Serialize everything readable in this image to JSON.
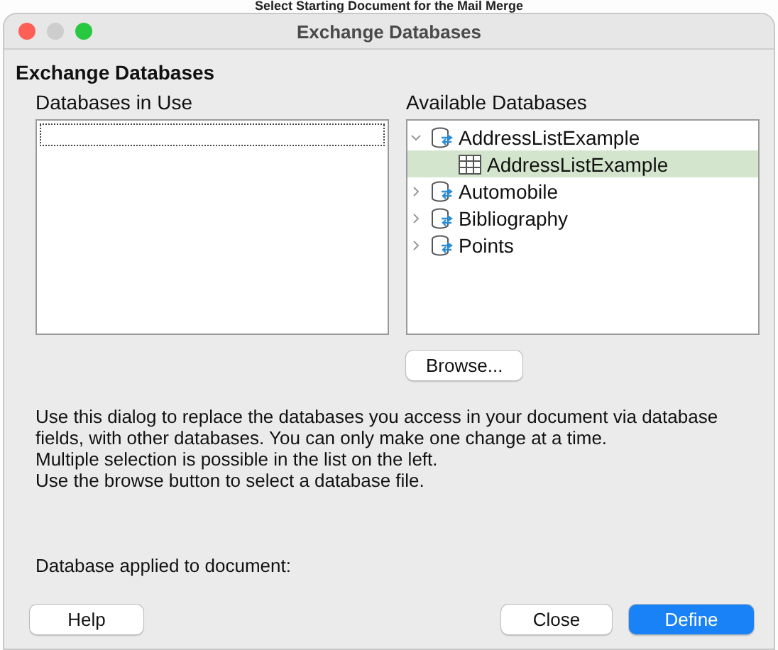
{
  "background_window": {
    "title": "Select Starting Document for the Mail Merge"
  },
  "window": {
    "title": "Exchange Databases"
  },
  "heading": "Exchange Databases",
  "databases_in_use": {
    "label": "Databases in Use"
  },
  "available_databases": {
    "label": "Available Databases",
    "items": [
      {
        "label": "AddressListExample",
        "kind": "database",
        "expanded": true,
        "selected": false,
        "children": [
          {
            "label": "AddressListExample",
            "kind": "table",
            "selected": true
          }
        ]
      },
      {
        "label": "Automobile",
        "kind": "database",
        "expanded": false,
        "selected": false
      },
      {
        "label": "Bibliography",
        "kind": "database",
        "expanded": false,
        "selected": false
      },
      {
        "label": "Points",
        "kind": "database",
        "expanded": false,
        "selected": false
      }
    ]
  },
  "browse_button": "Browse...",
  "description": [
    "Use this dialog to replace the databases you access in your document via database fields, with other databases. You can only make one change at a time.",
    "Multiple selection is possible in the list on the left.",
    "Use the browse button to select a database file."
  ],
  "applied_label": "Database applied to document:",
  "buttons": [
    {
      "label": "Help",
      "default": false
    },
    {
      "label": "Close",
      "default": false
    },
    {
      "label": "Define",
      "default": true
    }
  ]
}
